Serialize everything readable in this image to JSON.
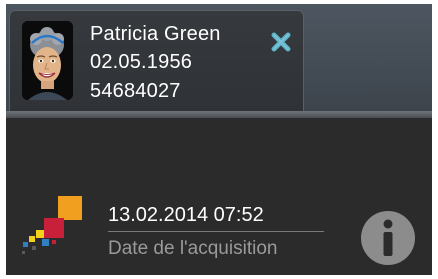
{
  "patient": {
    "name": "Patricia Green",
    "birth_date": "02.05.1956",
    "id": "54684027",
    "avatar_icon": "patient-avatar",
    "close_icon": "close-icon"
  },
  "acquisition": {
    "datetime": "13.02.2014 07:52",
    "label": "Date de l'acquisition",
    "logo_icon": "modality-logo",
    "info_icon": "info-icon"
  },
  "colors": {
    "close_icon": "#5fb3c9",
    "logo_orange": "#f0a01e",
    "logo_red": "#c8203a",
    "logo_yellow": "#f2d21a",
    "logo_blue": "#2f7fc1",
    "info_icon": "#8c8c8c"
  }
}
